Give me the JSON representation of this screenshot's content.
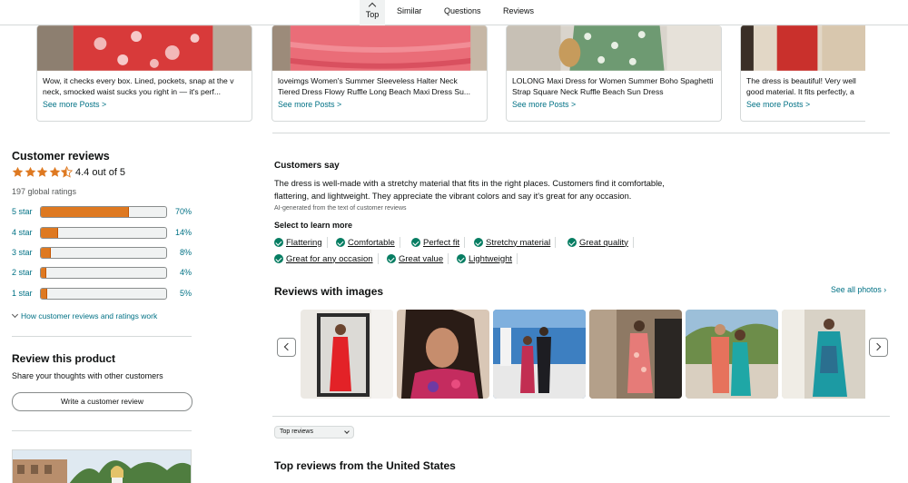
{
  "nav": {
    "top": "Top",
    "similar": "Similar",
    "questions": "Questions",
    "reviews": "Reviews"
  },
  "cards": [
    {
      "text": "Wow, it checks every box. Lined, pockets, snap at the v neck, smocked waist sucks you right in — it's perf...",
      "more": "See more Posts >"
    },
    {
      "text": "loveimgs Women's Summer Sleeveless Halter Neck Tiered Dress Flowy Ruffle Long Beach Maxi Dress Su...",
      "more": "See more Posts >"
    },
    {
      "text": "LOLONG Maxi Dress for Women Summer Boho Spaghetti Strap Square Neck Ruffle Beach Sun Dress",
      "more": "See more Posts >"
    },
    {
      "text": "The dress is beautiful! Very well good material. It fits perfectly, a",
      "more": "See more Posts >"
    }
  ],
  "reviews_summary": {
    "title": "Customer reviews",
    "rating": 4.4,
    "rating_text": "4.4 out of 5",
    "global_ratings": "197 global ratings",
    "histogram": [
      {
        "label": "5 star",
        "percent": 70,
        "pct_text": "70%"
      },
      {
        "label": "4 star",
        "percent": 14,
        "pct_text": "14%"
      },
      {
        "label": "3 star",
        "percent": 8,
        "pct_text": "8%"
      },
      {
        "label": "2 star",
        "percent": 4,
        "pct_text": "4%"
      },
      {
        "label": "1 star",
        "percent": 5,
        "pct_text": "5%"
      }
    ],
    "how_link": "How customer reviews and ratings work"
  },
  "review_product": {
    "title": "Review this product",
    "subtitle": "Share your thoughts with other customers",
    "button": "Write a customer review"
  },
  "customers_say": {
    "title": "Customers say",
    "body": "The dress is well-made with a stretchy material that fits in the right places. Customers find it comfortable, flattering, and lightweight. They appreciate the vibrant colors and say it's great for any occasion.",
    "ai_note": "AI-generated from the text of customer reviews",
    "select_label": "Select to learn more",
    "aspects": [
      "Flattering",
      "Comfortable",
      "Perfect fit",
      "Stretchy material",
      "Great quality",
      "Great for any occasion",
      "Great value",
      "Lightweight"
    ]
  },
  "reviews_with_images": {
    "title": "Reviews with images",
    "see_all": "See all photos ›"
  },
  "sort": {
    "selected": "Top reviews"
  },
  "top_reviews_title": "Top reviews from the United States",
  "colors": {
    "link": "#007185",
    "star": "#de7921",
    "check": "#067d62",
    "border": "#d5d9d9"
  }
}
